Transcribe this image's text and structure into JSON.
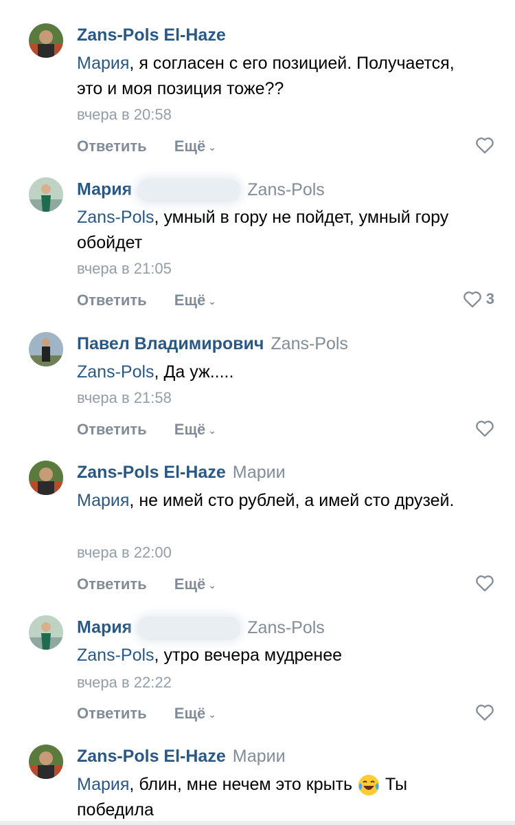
{
  "comments": [
    {
      "author": "Zans-Pols El-Haze",
      "reply_to": "",
      "mention": "Мария",
      "text": ", я согласен с его позицией. Получается, это и моя позиция тоже??",
      "time": "вчера в 20:58",
      "reply_label": "Ответить",
      "more_label": "Ещё",
      "likes": ""
    },
    {
      "author": "Мария",
      "reply_to": "Zans-Pols",
      "mention": "Zans-Pols",
      "text": ", умный в гору не пойдет, умный гору обойдет",
      "time": "вчера в 21:05",
      "reply_label": "Ответить",
      "more_label": "Ещё",
      "likes": "3"
    },
    {
      "author": "Павел Владимирович",
      "reply_to": "Zans-Pols",
      "mention": "Zans-Pols",
      "text": ", Да уж.....",
      "time": "вчера в 21:58",
      "reply_label": "Ответить",
      "more_label": "Ещё",
      "likes": ""
    },
    {
      "author": "Zans-Pols El-Haze",
      "reply_to": "Марии",
      "mention": "Мария",
      "text": ", не имей сто рублей, а имей сто друзей.",
      "time": "вчера в 22:00",
      "reply_label": "Ответить",
      "more_label": "Ещё",
      "likes": ""
    },
    {
      "author": "Мария",
      "reply_to": "Zans-Pols",
      "mention": "Zans-Pols",
      "text": ", утро вечера мудренее",
      "time": "вчера в 22:22",
      "reply_label": "Ответить",
      "more_label": "Ещё",
      "likes": ""
    },
    {
      "author": "Zans-Pols El-Haze",
      "reply_to": "Марии",
      "mention": "Мария",
      "text": ", блин, мне нечем это крыть",
      "text_after": " Ты победила",
      "emoji": "tears-of-joy-emoji",
      "time": "",
      "reply_label": "",
      "more_label": "",
      "likes": ""
    }
  ],
  "colors": {
    "link": "#2a5885",
    "secondary": "#818c99",
    "time": "#939da8"
  },
  "icons": [
    "heart-icon",
    "chevron-down-icon",
    "avatar",
    "tears-of-joy-emoji"
  ]
}
